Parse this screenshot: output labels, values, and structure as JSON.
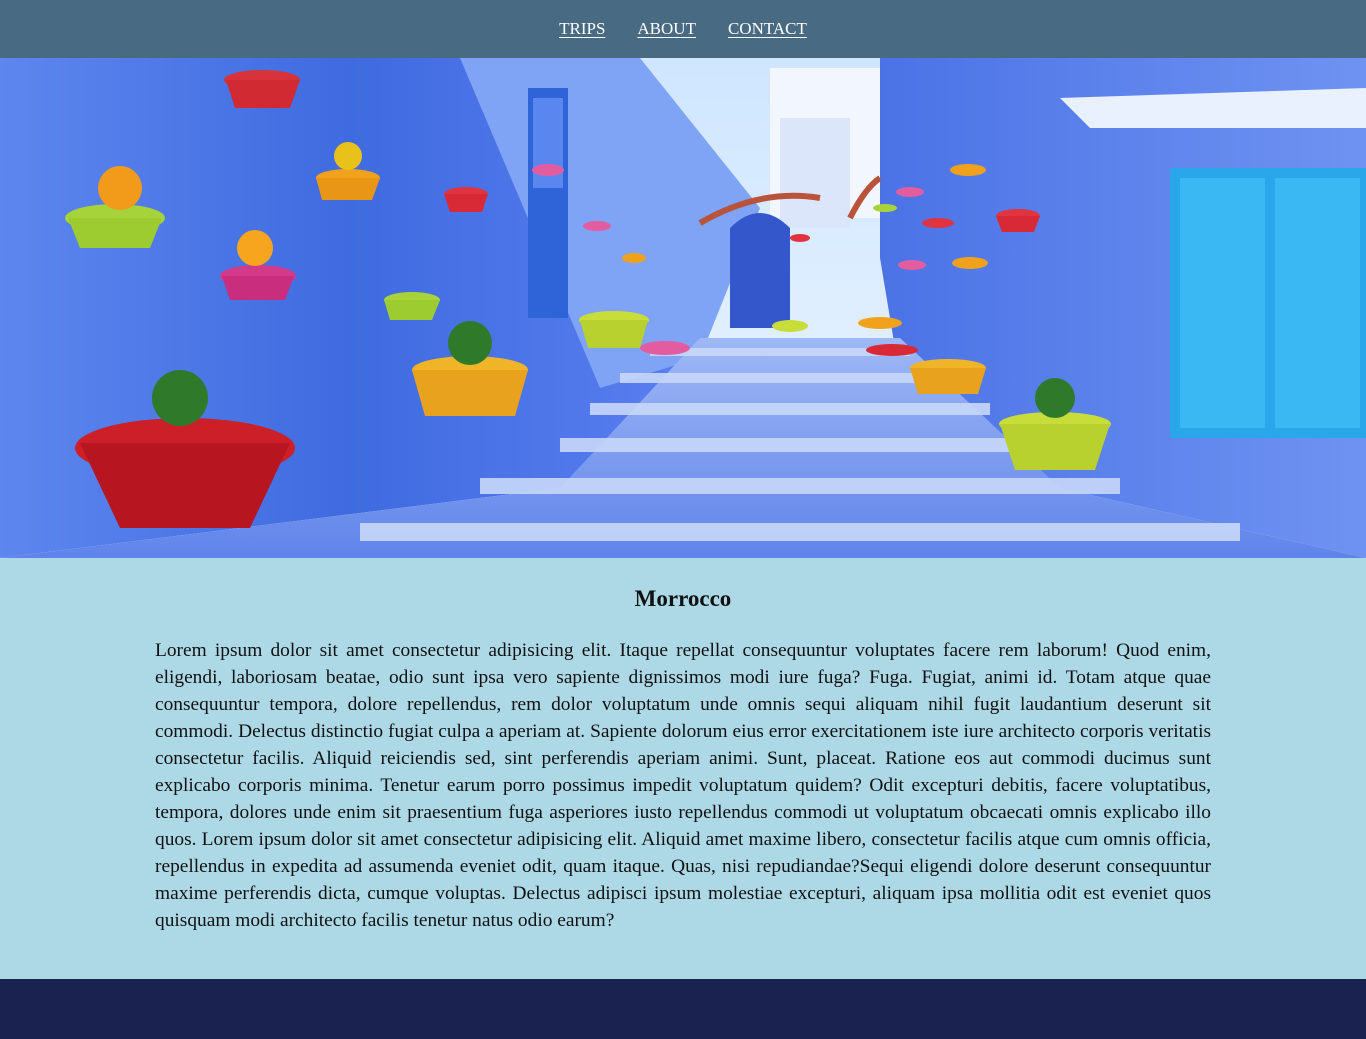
{
  "nav": {
    "items": [
      {
        "label": "TRIPS"
      },
      {
        "label": "ABOUT"
      },
      {
        "label": "CONTACT"
      }
    ]
  },
  "hero": {
    "image_subject": "blue-painted-street-with-flower-pots"
  },
  "article": {
    "title": "Morrocco",
    "body": "Lorem ipsum dolor sit amet consectetur adipisicing elit. Itaque repellat consequuntur voluptates facere rem laborum! Quod enim, eligendi, laboriosam beatae, odio sunt ipsa vero sapiente dignissimos modi iure fuga? Fuga. Fugiat, animi id. Totam atque quae consequuntur tempora, dolore repellendus, rem dolor voluptatum unde omnis sequi aliquam nihil fugit laudantium deserunt sit commodi. Delectus distinctio fugiat culpa a aperiam at. Sapiente dolorum eius error exercitationem iste iure architecto corporis veritatis consectetur facilis. Aliquid reiciendis sed, sint perferendis aperiam animi. Sunt, placeat. Ratione eos aut commodi ducimus sunt explicabo corporis minima. Tenetur earum porro possimus impedit voluptatum quidem? Odit excepturi debitis, facere voluptatibus, tempora, dolores unde enim sit praesentium fuga asperiores iusto repellendus commodi ut voluptatum obcaecati omnis explicabo illo quos. Lorem ipsum dolor sit amet consectetur adipisicing elit. Aliquid amet maxime libero, consectetur facilis atque cum omnis officia, repellendus in expedita ad assumenda eveniet odit, quam itaque. Quas, nisi repudiandae?Sequi eligendi dolore deserunt consequuntur maxime perferendis dicta, cumque voluptas. Delectus adipisci ipsum molestiae excepturi, aliquam ipsa mollitia odit est eveniet quos quisquam modi architecto facilis tenetur natus odio earum?"
  },
  "colors": {
    "nav_bg": "#486a82",
    "content_bg": "#add8e6",
    "footer_bg": "#1a2250"
  }
}
